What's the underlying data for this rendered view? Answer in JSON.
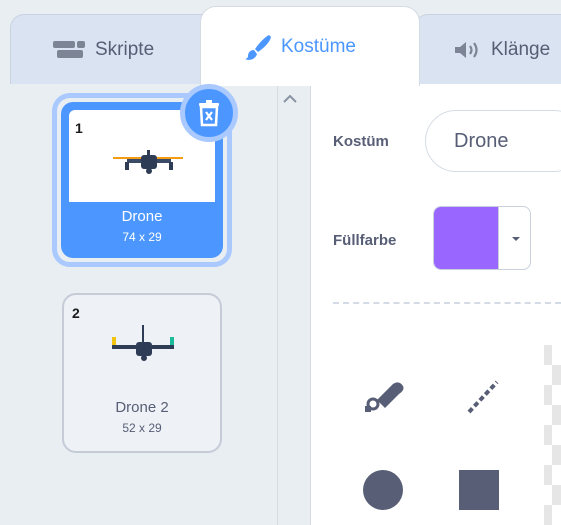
{
  "tabs": {
    "scripts": "Skripte",
    "costumes": "Kostüme",
    "sounds": "Klänge"
  },
  "costumes": [
    {
      "index": "1",
      "name": "Drone",
      "size": "74 x 29",
      "selected": true
    },
    {
      "index": "2",
      "name": "Drone 2",
      "size": "52 x 29",
      "selected": false
    }
  ],
  "editor": {
    "costume_label": "Kostüm",
    "costume_name": "Drone",
    "fill_label": "Füllfarbe",
    "fill_color": "#9966ff"
  },
  "colors": {
    "accent": "#4c97ff",
    "text": "#575e75",
    "tool": "#575e75"
  },
  "icons": {
    "scripts": "code-blocks-icon",
    "costumes": "paintbrush-icon",
    "sounds": "speaker-icon",
    "delete": "trash-icon",
    "scroll_up": "chevron-up-icon",
    "dropdown": "caret-down-icon",
    "tools": [
      "reshape-icon",
      "line-icon",
      "circle-icon",
      "rectangle-icon"
    ]
  }
}
